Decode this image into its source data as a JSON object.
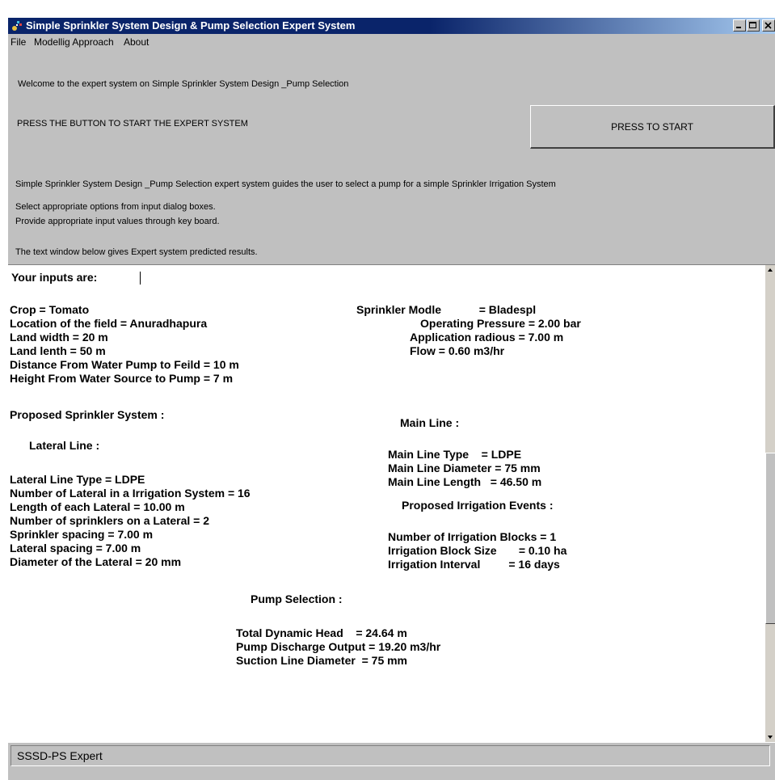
{
  "window": {
    "title": "Simple Sprinkler System Design & Pump Selection Expert System"
  },
  "menu": [
    "File",
    "Modellig Approach",
    "About"
  ],
  "header": {
    "welcome": "Welcome to the expert system on Simple Sprinkler System Design _Pump Selection",
    "press_instruction": "PRESS THE BUTTON TO START THE EXPERT SYSTEM",
    "start_button": "PRESS TO START",
    "description": "Simple Sprinkler System Design _Pump Selection expert system guides the user to select a pump for a simple Sprinkler Irrigation System",
    "instruction_1": "Select appropriate options from input dialog boxes.",
    "instruction_2": "Provide appropriate input values through key board.",
    "instruction_3": "The text window below gives Expert system predicted results."
  },
  "results": {
    "heading": "Your inputs are:",
    "inputs_left": [
      "Crop = Tomato",
      "Location of the field = Anuradhapura",
      "Land width = 20 m",
      "Land lenth = 50 m",
      "Distance From Water Pump to Feild = 10 m",
      "Height From Water Source to Pump = 7 m"
    ],
    "sprinkler_model": "Sprinkler Modle            = Bladespl",
    "inputs_right": [
      "Operating Pressure = 2.00 bar",
      "Application radious = 7.00 m",
      "Flow = 0.60 m3/hr"
    ],
    "proposed_heading": "Proposed Sprinkler System :",
    "lateral_heading": "Lateral Line :",
    "lateral_lines": [
      "Lateral Line Type = LDPE",
      "Number of Lateral in a Irrigation System = 16",
      "Length of each Lateral = 10.00 m",
      "Number of sprinklers on a Lateral = 2",
      "Sprinkler spacing = 7.00 m",
      "Lateral spacing = 7.00 m",
      "Diameter of the Lateral = 20 mm"
    ],
    "main_heading": "Main Line :",
    "main_lines": [
      "Main Line Type    = LDPE",
      "Main Line Diameter = 75 mm",
      "Main Line Length   = 46.50 m"
    ],
    "events_heading": "Proposed Irrigation Events :",
    "events_lines": [
      "Number of Irrigation Blocks = 1",
      "Irrigation Block Size       = 0.10 ha",
      "Irrigation Interval         = 16 days"
    ],
    "pump_heading": "Pump Selection :",
    "pump_lines": [
      "Total Dynamic Head    = 24.64 m",
      "Pump Discharge Output = 19.20 m3/hr",
      "Suction Line Diameter  = 75 mm"
    ]
  },
  "status": "SSSD-PS Expert"
}
